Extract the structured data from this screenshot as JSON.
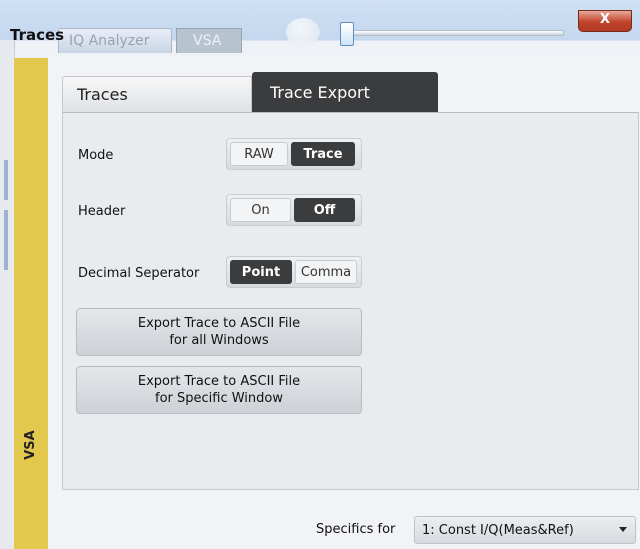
{
  "background": {
    "tab_iq": "IQ Analyzer",
    "tab_vsa": "VSA",
    "close_label": "X"
  },
  "dialog": {
    "title": "Traces",
    "side_label": "VSA"
  },
  "tabs": [
    {
      "label": "Traces",
      "active": false
    },
    {
      "label": "Trace Export",
      "active": true
    }
  ],
  "mode": {
    "label": "Mode",
    "options": [
      "RAW",
      "Trace"
    ],
    "selected": "Trace"
  },
  "header": {
    "label": "Header",
    "options": [
      "On",
      "Off"
    ],
    "selected": "Off"
  },
  "decimal": {
    "label": "Decimal Seperator",
    "options": [
      "Point",
      "Comma"
    ],
    "selected": "Point"
  },
  "buttons": {
    "export_all_line1": "Export Trace to ASCII File",
    "export_all_line2": "for all Windows",
    "export_specific_line1": "Export Trace to ASCII File",
    "export_specific_line2": "for Specific Window"
  },
  "footer": {
    "specifics_label": "Specifics for",
    "specifics_value": "1: Const I/Q(Meas&Ref)"
  },
  "colors": {
    "side_bar": "#e2c94e",
    "active_tab": "#3b3c3e",
    "close_button": "#c0432a"
  }
}
